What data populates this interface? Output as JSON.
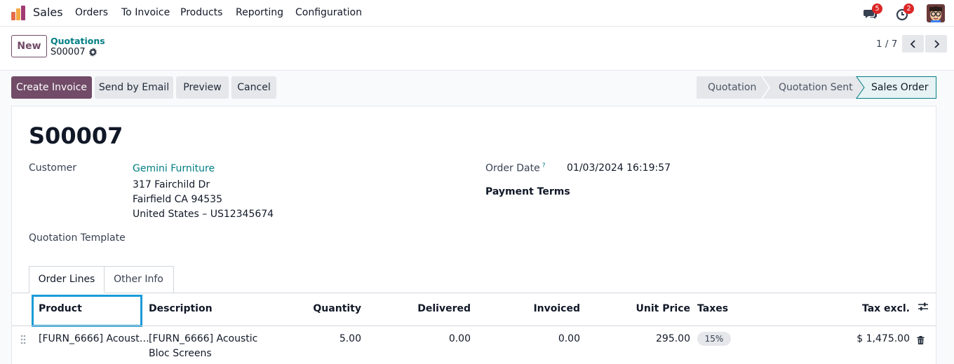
{
  "navbar": {
    "app_name": "Sales",
    "menu": [
      "Orders",
      "To Invoice",
      "Products",
      "Reporting",
      "Configuration"
    ],
    "messages_badge": "5",
    "activities_badge": "2",
    "icons": [
      "app-logo-icon",
      "chat-icon",
      "clock-icon",
      "avatar"
    ]
  },
  "control_panel": {
    "new_label": "New",
    "breadcrumb_parent": "Quotations",
    "breadcrumb_current": "S00007",
    "pager": "1 / 7"
  },
  "actions": {
    "create_invoice": "Create Invoice",
    "send_email": "Send by Email",
    "preview": "Preview",
    "cancel": "Cancel"
  },
  "statusbar": {
    "stages": [
      "Quotation",
      "Quotation Sent",
      "Sales Order"
    ],
    "active": "Sales Order"
  },
  "form": {
    "title": "S00007",
    "customer_label": "Customer",
    "customer_name": "Gemini Furniture",
    "address_line1": "317 Fairchild Dr",
    "address_line2": "Fairfield CA 94535",
    "address_line3": "United States – US12345674",
    "order_date_label": "Order Date",
    "order_date_help": "?",
    "order_date": "01/03/2024 16:19:57",
    "payment_terms_label": "Payment Terms",
    "quotation_template_label": "Quotation Template"
  },
  "tabs": [
    "Order Lines",
    "Other Info"
  ],
  "table": {
    "headers": {
      "product": "Product",
      "description": "Description",
      "quantity": "Quantity",
      "delivered": "Delivered",
      "invoiced": "Invoiced",
      "unit_price": "Unit Price",
      "taxes": "Taxes",
      "tax_excl": "Tax excl."
    },
    "rows": [
      {
        "product": "[FURN_6666] Acoust…",
        "description_line1": "[FURN_6666] Acoustic",
        "description_line2": "Bloc Screens",
        "quantity": "5.00",
        "delivered": "0.00",
        "invoiced": "0.00",
        "unit_price": "295.00",
        "taxes": "15%",
        "tax_excl": "$ 1,475.00"
      }
    ]
  },
  "colors": {
    "primary": "#714b67",
    "link": "#017e84",
    "highlight": "#1a9bd7",
    "badge": "#dc2626"
  }
}
